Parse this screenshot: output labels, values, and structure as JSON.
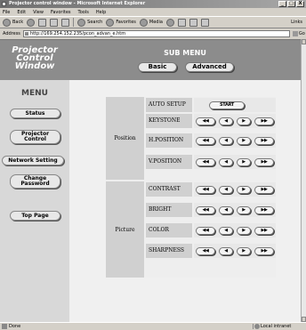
{
  "window": {
    "title": "Projector control window - Microsoft Internet Explorer",
    "buttons": [
      "_",
      "□",
      "X"
    ]
  },
  "menubar": [
    "File",
    "Edit",
    "View",
    "Favorites",
    "Tools",
    "Help"
  ],
  "toolbar": {
    "back": "Back",
    "search": "Search",
    "favorites": "Favorites",
    "media": "Media",
    "links": "Links"
  },
  "address": {
    "label": "Address",
    "value": "http://169.254.152.235/pcon_advan_e.htm",
    "go": "Go"
  },
  "sidebar": {
    "logo_lines": [
      "Projector",
      "Control",
      "Window"
    ],
    "menu_title": "MENU",
    "buttons": {
      "status": "Status",
      "projector_control": [
        "Projector",
        "Control"
      ],
      "network_setting": "Network Setting",
      "change_password": [
        "Change",
        "Password"
      ],
      "top_page": "Top Page"
    }
  },
  "submenu": {
    "title": "SUB MENU",
    "basic": "Basic",
    "advanced": "Advanced"
  },
  "controls": {
    "groups": {
      "position": "Position",
      "picture": "Picture"
    },
    "rows": {
      "auto_setup": "AUTO SETUP",
      "keystone": "KEYSTONE",
      "h_position": "H.POSITION",
      "v_position": "V.POSITION",
      "contrast": "CONTRAST",
      "bright": "BRIGHT",
      "color": "COLOR",
      "sharpness": "SHARPNESS"
    },
    "start": "START",
    "glyphs": {
      "fast_left": "◀◀",
      "left": "◀",
      "right": "▶",
      "fast_right": "▶▶"
    }
  },
  "status": {
    "left": "Done",
    "right": "Local intranet"
  }
}
